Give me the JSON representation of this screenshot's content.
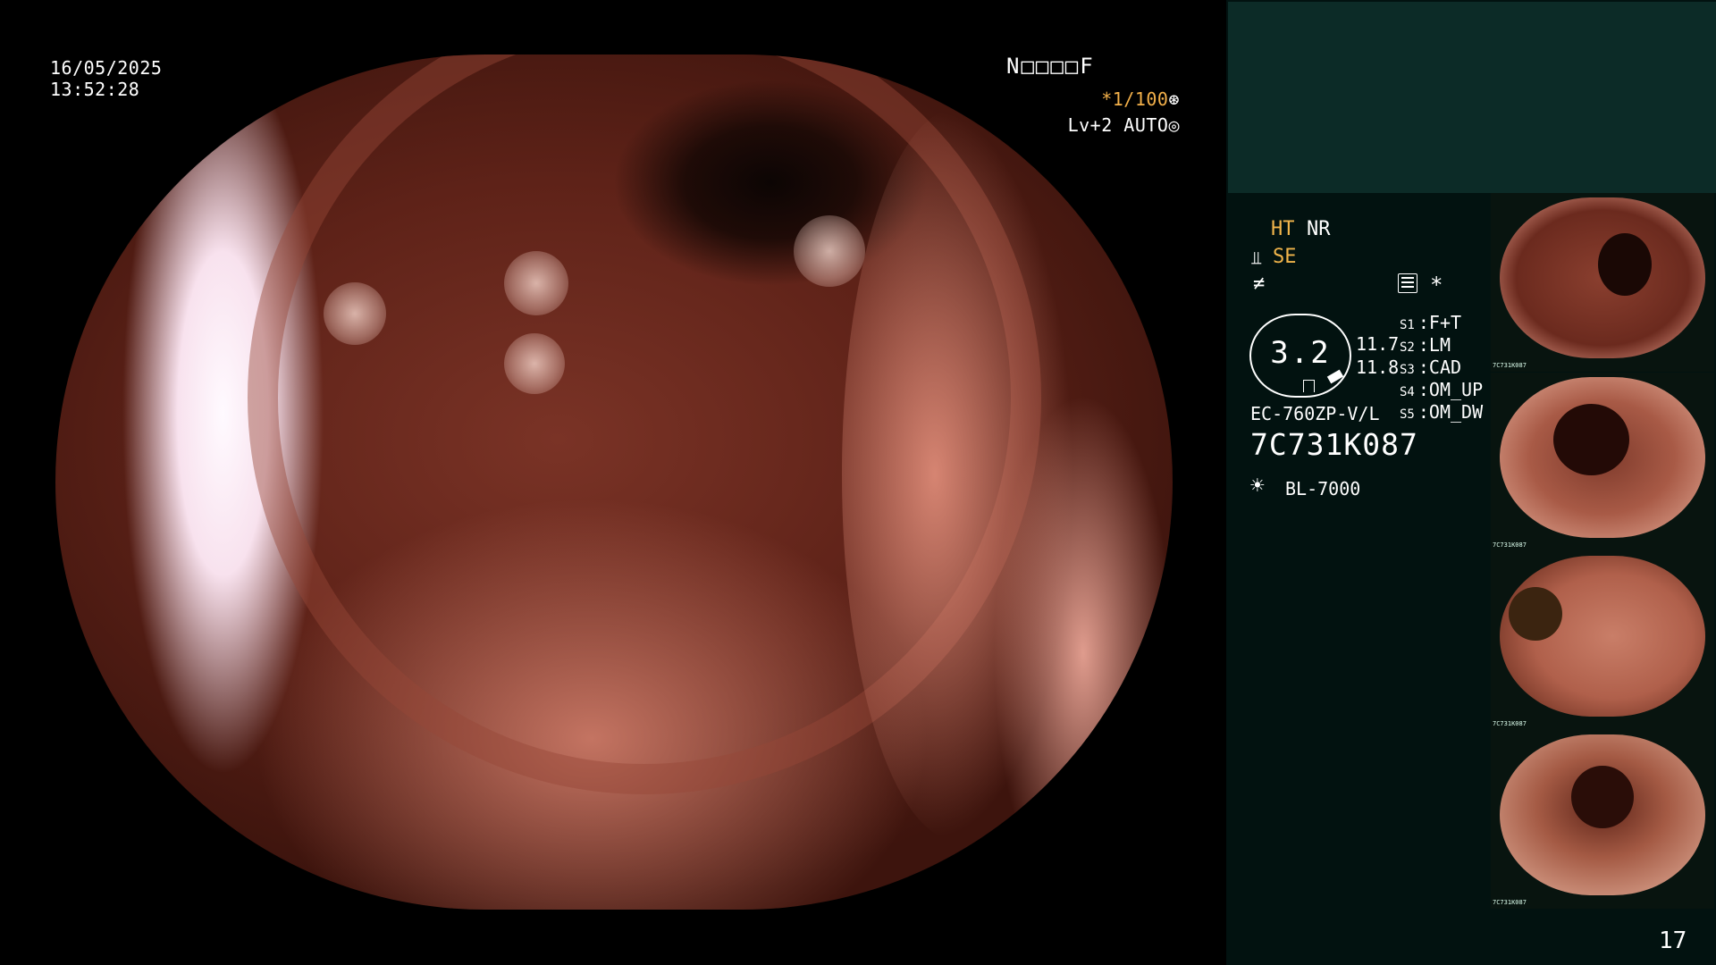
{
  "overlay": {
    "date": "16/05/2025",
    "time": "13:52:28",
    "patient_id": "N□□□□F",
    "shutter": "*1/100",
    "level": "Lv+2 AUTO"
  },
  "panel": {
    "mode_ht": "HT",
    "mode_nr": "NR",
    "mode_se": "SE",
    "star": "*",
    "dial_value": "3.2",
    "value_1": "11.7",
    "value_2": "11.8",
    "switches": [
      {
        "key": "S1",
        "label": "F+T"
      },
      {
        "key": "S2",
        "label": "LM"
      },
      {
        "key": "S3",
        "label": "CAD"
      },
      {
        "key": "S4",
        "label": "OM_UP"
      },
      {
        "key": "S5",
        "label": "OM_DW"
      }
    ],
    "scope_model": "EC-760ZP-V/L",
    "serial": "7C731K087",
    "light_source": "BL-7000",
    "page_number": "17"
  },
  "thumbnails": [
    {
      "caption": "7C731K087"
    },
    {
      "caption": "7C731K087"
    },
    {
      "caption": "7C731K087"
    },
    {
      "caption": "7C731K087"
    }
  ],
  "colors": {
    "accent_amber": "#f1b54b",
    "shutter_orange": "#f3b04a",
    "panel_top": "#0c2b27",
    "panel_bg": "#021210"
  }
}
